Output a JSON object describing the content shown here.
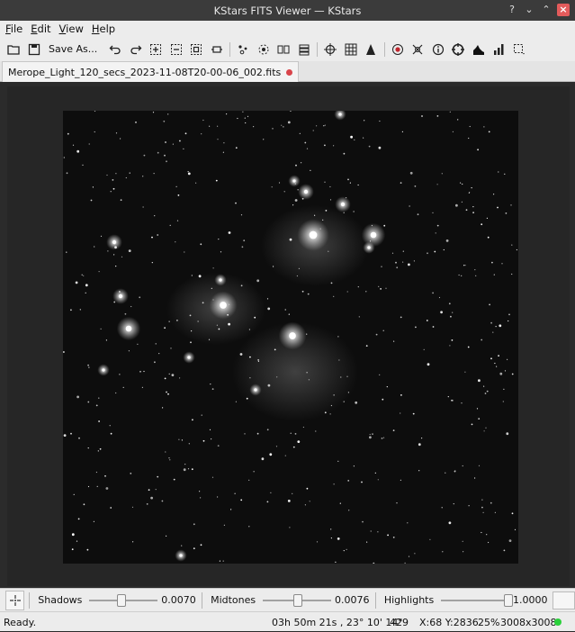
{
  "window": {
    "title": "KStars FITS Viewer — KStars"
  },
  "menu": [
    "File",
    "Edit",
    "View",
    "Help"
  ],
  "toolbar": {
    "save_as_label": "Save As...",
    "icons": [
      "open-icon",
      "save-icon",
      "undo-icon",
      "redo-icon",
      "zoom-in-icon",
      "zoom-out-icon",
      "zoom-fit-icon",
      "zoom-width-icon",
      "find-stars-icon",
      "mark-stars-icon",
      "crosshair-icon",
      "pixel-grid-icon",
      "eq-grid-icon",
      "objects-icon",
      "star-profile-icon",
      "hips-icon",
      "info-icon",
      "target-icon",
      "histogram-icon",
      "statistics-icon",
      "selection-icon"
    ]
  },
  "tab": {
    "label": "Merope_Light_120_secs_2023-11-08T20-00-06_002.fits"
  },
  "stretch": {
    "shadows_label": "Shadows",
    "shadows_value": "0.0070",
    "shadows_fraction": 0.45,
    "midtones_label": "Midtones",
    "midtones_value": "0.0076",
    "midtones_fraction": 0.5,
    "highlights_label": "Highlights",
    "highlights_value": "1.0000",
    "highlights_fraction": 0.97
  },
  "status": {
    "state": "Ready.",
    "coords": "03h 50m 21s ,  23° 10' 14\"",
    "pixel_value": "429",
    "xy": "X:68 Y:2836",
    "zoom": "25%",
    "size": "3008x3008",
    "led_color": "#2ad13b"
  }
}
